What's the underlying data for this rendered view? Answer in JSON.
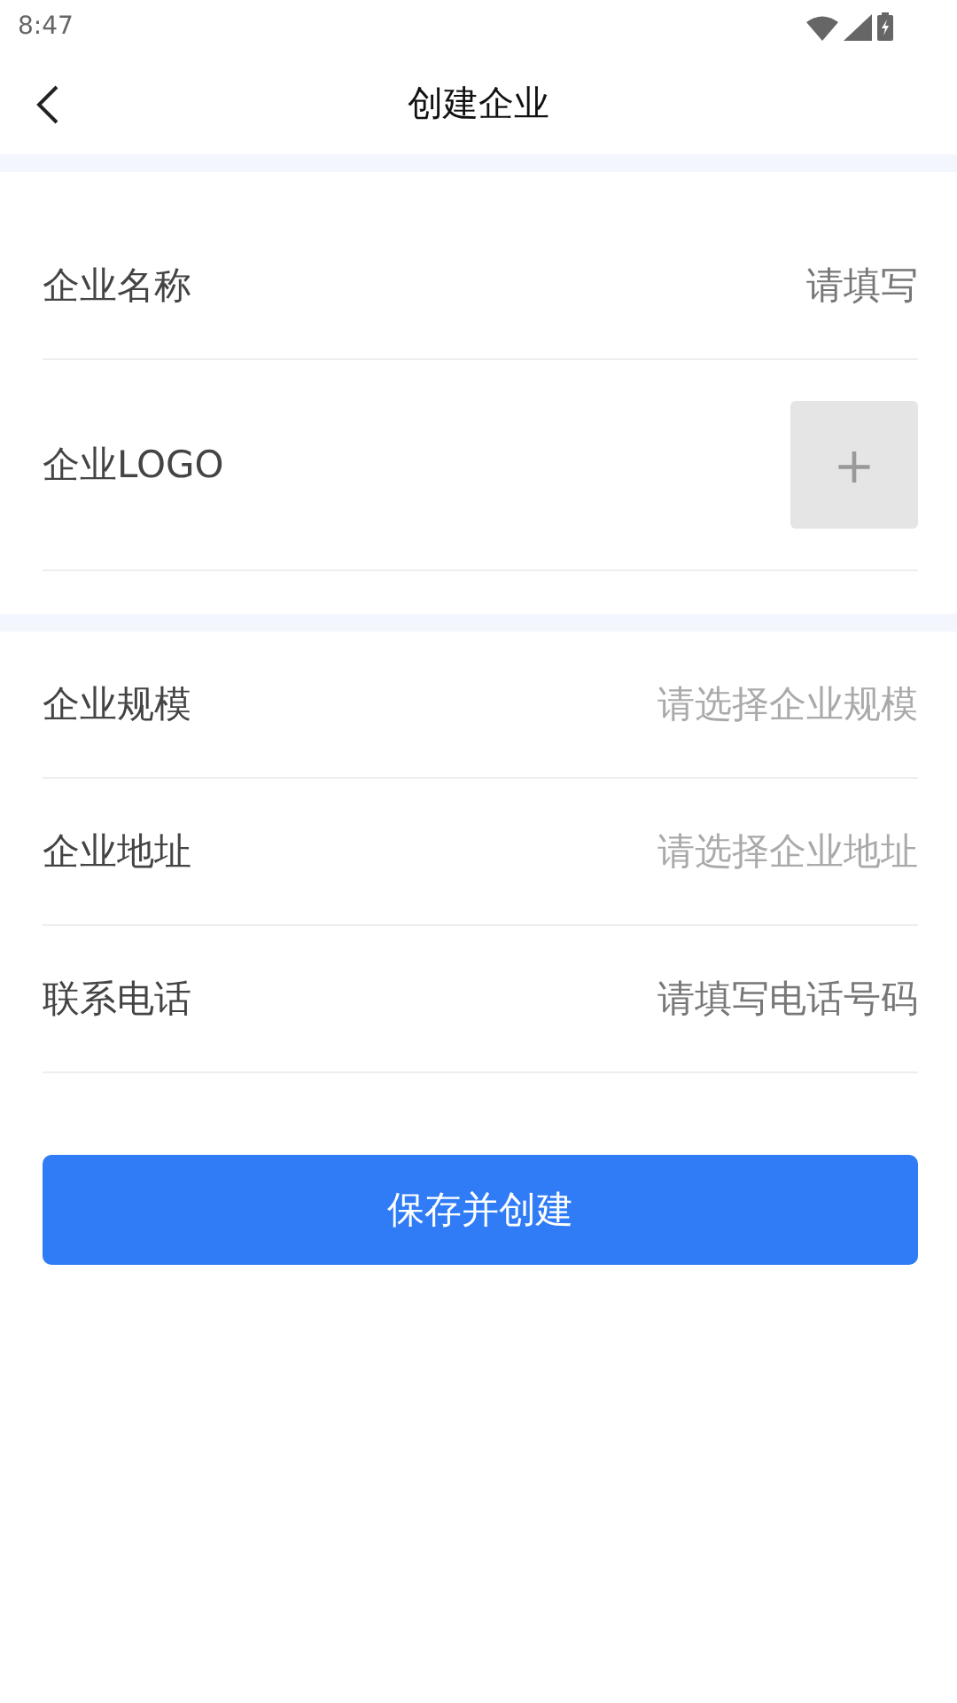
{
  "status_bar": {
    "time": "8:47"
  },
  "header": {
    "title": "创建企业"
  },
  "sections": [
    {
      "rows": [
        {
          "kind": "input",
          "label": "企业名称",
          "placeholder": "请填写"
        },
        {
          "kind": "upload",
          "label": "企业LOGO",
          "button": "+"
        }
      ]
    },
    {
      "rows": [
        {
          "kind": "select",
          "label": "企业规模",
          "placeholder": "请选择企业规模"
        },
        {
          "kind": "select",
          "label": "企业地址",
          "placeholder": "请选择企业地址"
        },
        {
          "kind": "input",
          "label": "联系电话",
          "placeholder": "请填写电话号码"
        }
      ]
    }
  ],
  "submit_button": "保存并创建"
}
